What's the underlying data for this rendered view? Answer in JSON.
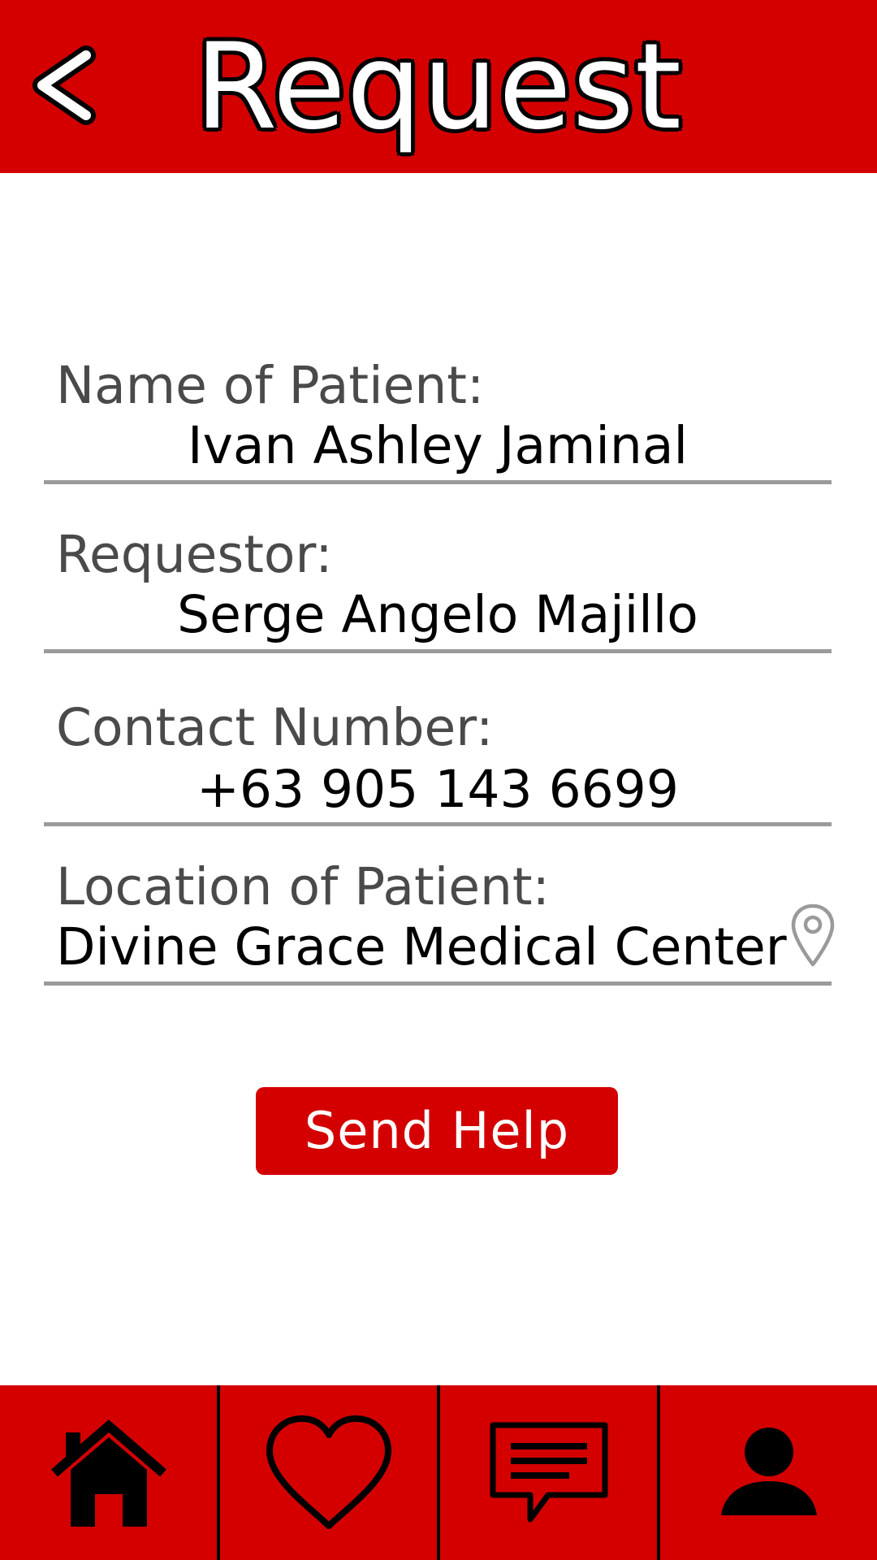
{
  "header": {
    "back_label": "<",
    "title": "Request"
  },
  "form": {
    "patient_name": {
      "label": "Name of Patient:",
      "value": "Ivan Ashley Jaminal"
    },
    "requestor": {
      "label": "Requestor:",
      "value": "Serge Angelo Majillo"
    },
    "contact_number": {
      "label": "Contact Number:",
      "value": "+63 905 143 6699"
    },
    "location": {
      "label": "Location of Patient:",
      "value": "Divine Grace Medical Center",
      "icon": "map-pin-icon"
    }
  },
  "send_button": {
    "label": "Send Help"
  },
  "bottom_nav": {
    "items": [
      {
        "icon": "home-icon"
      },
      {
        "icon": "heart-icon"
      },
      {
        "icon": "chat-icon"
      },
      {
        "icon": "profile-icon"
      }
    ]
  },
  "colors": {
    "brand_red": "#d40000",
    "label_gray": "#4a4a4a",
    "line_gray": "#9a9a9a"
  }
}
